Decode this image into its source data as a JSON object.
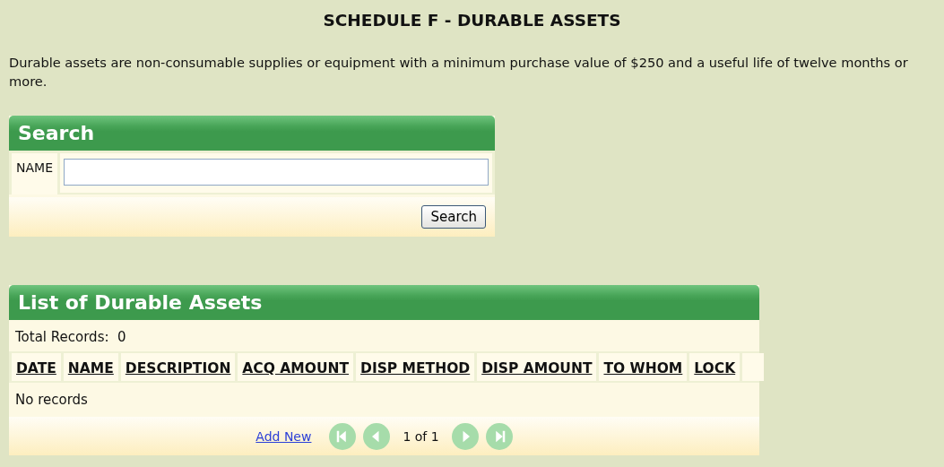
{
  "title": "SCHEDULE F - DURABLE ASSETS",
  "description": "Durable assets are non-consumable supplies or equipment with a minimum purchase value of $250 and a useful life of twelve months or more.",
  "search_panel": {
    "title": "Search",
    "field_label": "NAME",
    "button": "Search"
  },
  "list_panel": {
    "title": "List of Durable Assets",
    "total_label": "Total Records:",
    "total": "0",
    "columns": [
      "DATE",
      "NAME",
      "DESCRIPTION",
      "ACQ AMOUNT",
      "DISP METHOD",
      "DISP AMOUNT",
      "TO WHOM",
      "LOCK"
    ],
    "empty_message": "No records",
    "add_link": "Add New",
    "page_info": "1 of 1",
    "pager": [
      {
        "kind": "first",
        "disabled": true
      },
      {
        "kind": "prev",
        "disabled": true
      },
      {
        "kind": "next",
        "disabled": true
      },
      {
        "kind": "last",
        "disabled": true
      }
    ]
  }
}
